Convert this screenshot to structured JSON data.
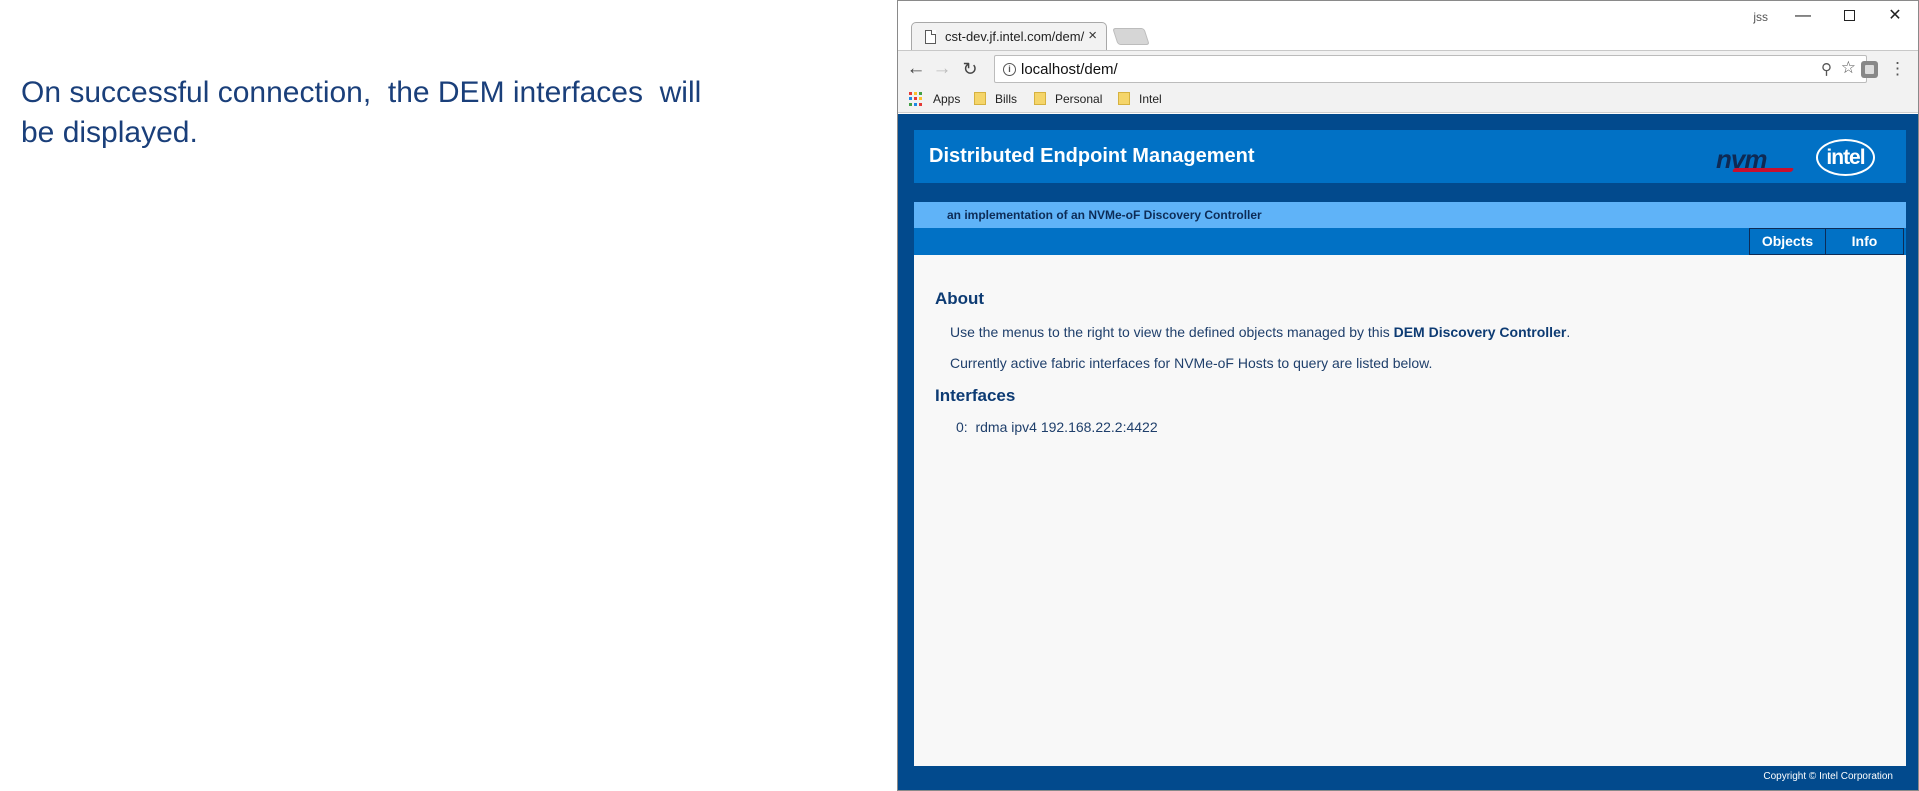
{
  "slide": {
    "caption_line1": "On successful connection,  the DEM interfaces  will",
    "caption_line2": "be displayed."
  },
  "browser": {
    "tab_title": "cst-dev.jf.intel.com/dem/",
    "tab_close": "×",
    "profile_label": "jss",
    "window_controls": {
      "minimize": "—",
      "close": "✕"
    },
    "url": "localhost/dem/",
    "bookmarks": [
      {
        "label": "Apps",
        "icon": "apps-grid-icon"
      },
      {
        "label": "Bills",
        "icon": "folder-icon"
      },
      {
        "label": "Personal",
        "icon": "folder-icon"
      },
      {
        "label": "Intel",
        "icon": "folder-icon"
      }
    ],
    "apps_colors": [
      "#e53935",
      "#fbc02d",
      "#43a047",
      "#1e88e5",
      "#e53935",
      "#fbc02d",
      "#43a047",
      "#1e88e5",
      "#e53935"
    ]
  },
  "page": {
    "title": "Distributed Endpoint Management",
    "logo_nvm": "nvm",
    "logo_intel": "intel",
    "subtitle": "an implementation of an NVMe-oF Discovery Controller",
    "menu": [
      "Objects",
      "Info"
    ],
    "about_heading": "About",
    "about_text_1_pre": "Use the menus to the right to view the defined objects managed by this ",
    "about_text_1_bold": "DEM Discovery Controller",
    "about_text_1_post": ".",
    "about_text_2": "Currently active fabric interfaces for NVMe-oF Hosts to query are listed below.",
    "interfaces_heading": "Interfaces",
    "interfaces": [
      {
        "index": "0:",
        "value": "rdma ipv4 192.168.22.2:4422"
      }
    ],
    "footer": "Copyright © Intel Corporation"
  },
  "colors": {
    "page_bg": "#024a8d",
    "header_bg": "#0171c5",
    "subbar_bg": "#5fb3f8",
    "text_navy": "#0d3b73"
  }
}
